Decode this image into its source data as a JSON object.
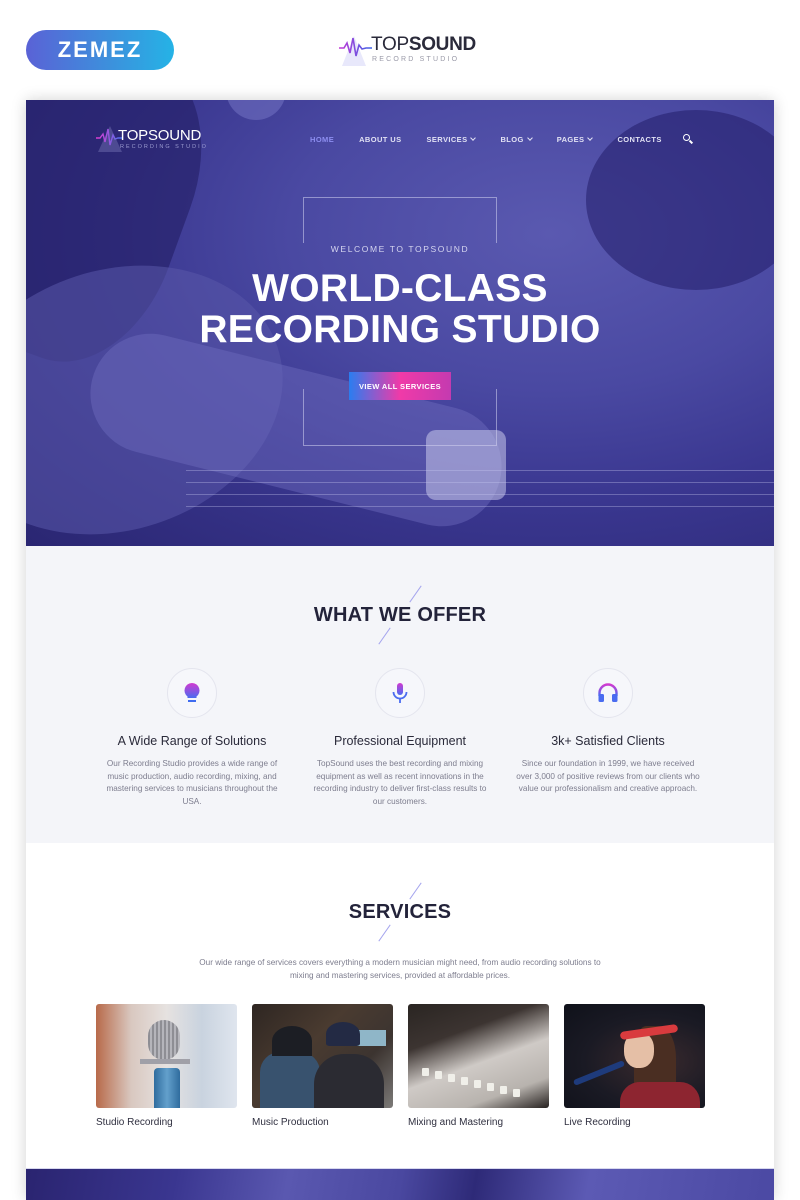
{
  "promo": {
    "zemez_logo": "ZEMEZ",
    "brand_light": "TOP",
    "brand_bold": "SOUND",
    "brand_subtitle": "RECORD STUDIO"
  },
  "header": {
    "logo_text": "TOPSOUND",
    "logo_subtitle": "RECORDING STUDIO",
    "nav": [
      {
        "label": "HOME",
        "active": true,
        "dropdown": false
      },
      {
        "label": "ABOUT US",
        "active": false,
        "dropdown": false
      },
      {
        "label": "SERVICES",
        "active": false,
        "dropdown": true
      },
      {
        "label": "BLOG",
        "active": false,
        "dropdown": true
      },
      {
        "label": "PAGES",
        "active": false,
        "dropdown": true
      },
      {
        "label": "CONTACTS",
        "active": false,
        "dropdown": false
      }
    ],
    "search_icon": "search-icon"
  },
  "hero": {
    "kicker": "WELCOME TO TOPSOUND",
    "title_line1": "WORLD-CLASS",
    "title_line2": "RECORDING STUDIO",
    "cta_label": "VIEW ALL SERVICES"
  },
  "offer": {
    "title": "WHAT WE OFFER",
    "features": [
      {
        "icon": "lightbulb-icon",
        "title": "A Wide Range of Solutions",
        "text": "Our Recording Studio provides a wide range of music production, audio recording, mixing, and mastering services to musicians throughout the USA."
      },
      {
        "icon": "microphone-icon",
        "title": "Professional Equipment",
        "text": "TopSound uses the best recording and mixing equipment as well as recent innovations in the recording industry to deliver first-class results to our customers."
      },
      {
        "icon": "headphones-icon",
        "title": "3k+ Satisfied Clients",
        "text": "Since our foundation in 1999, we have received over 3,000 of positive reviews from our clients who value our professionalism and creative approach."
      }
    ]
  },
  "services": {
    "title": "SERVICES",
    "intro": "Our wide range of services covers everything a modern musician might need, from audio recording solutions to mixing and mastering services, provided at affordable prices.",
    "items": [
      {
        "label": "Studio Recording"
      },
      {
        "label": "Music Production"
      },
      {
        "label": "Mixing and Mastering"
      },
      {
        "label": "Live Recording"
      }
    ]
  },
  "colors": {
    "hero_overlay": "#3a3790",
    "nav_active": "#8d8ef0",
    "accent_blue": "#2a7df0",
    "accent_pink": "#f03aa8",
    "heading_dark": "#23233a",
    "section_bg": "#f4f5f9"
  }
}
